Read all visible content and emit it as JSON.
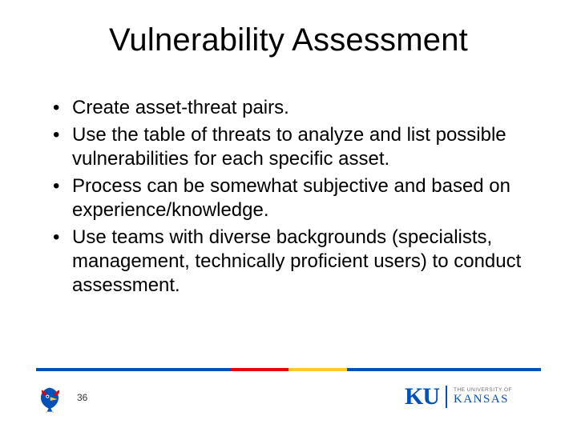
{
  "title": "Vulnerability Assessment",
  "bullets": [
    "Create asset-threat pairs.",
    "Use the table of threats to analyze and list possible vulnerabilities for each specific asset.",
    "Process can be somewhat subjective and based on experience/knowledge.",
    "Use teams with diverse backgrounds (specialists, management, technically proficient users) to conduct assessment."
  ],
  "page_number": "36",
  "ku": {
    "line1": "THE UNIVERSITY OF",
    "line2": "KANSAS",
    "mark": "KU"
  }
}
